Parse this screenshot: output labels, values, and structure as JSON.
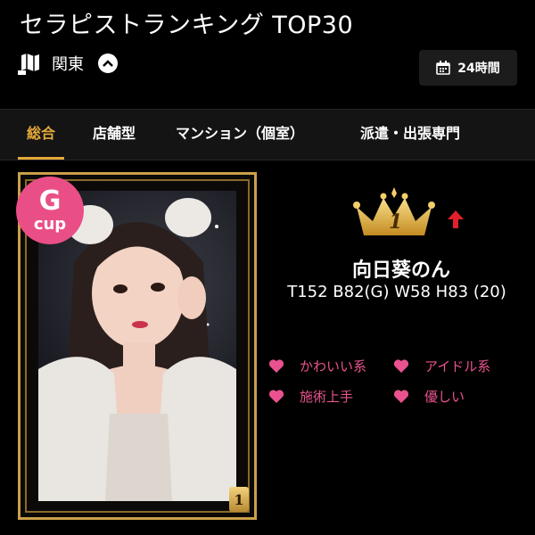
{
  "header": {
    "title": "セラピストランキング TOP30"
  },
  "region": {
    "label": "関東",
    "icon": "map-icon",
    "toggle_icon": "chevron-up-icon"
  },
  "period_button": {
    "label": "24時間",
    "icon": "calendar-icon"
  },
  "tabs": [
    {
      "label": "総合",
      "active": true
    },
    {
      "label": "店舗型",
      "active": false
    },
    {
      "label": "マンション（個室）",
      "active": false
    },
    {
      "label": "派遣・出張専門",
      "active": false
    }
  ],
  "therapist": {
    "cup_letter": "G",
    "cup_text": "cup",
    "rank": "1",
    "trend": "up",
    "name": "向日葵のん",
    "stats": "T152 B82(G) W58 H83 (20)",
    "tags": [
      "かわいい系",
      "アイドル系",
      "施術上手",
      "優しい"
    ]
  },
  "colors": {
    "accent": "#e4a93a",
    "tag": "#e9528e",
    "badge": "#e94f86",
    "trend_up": "#e0202c",
    "gold": "#caa04a"
  }
}
